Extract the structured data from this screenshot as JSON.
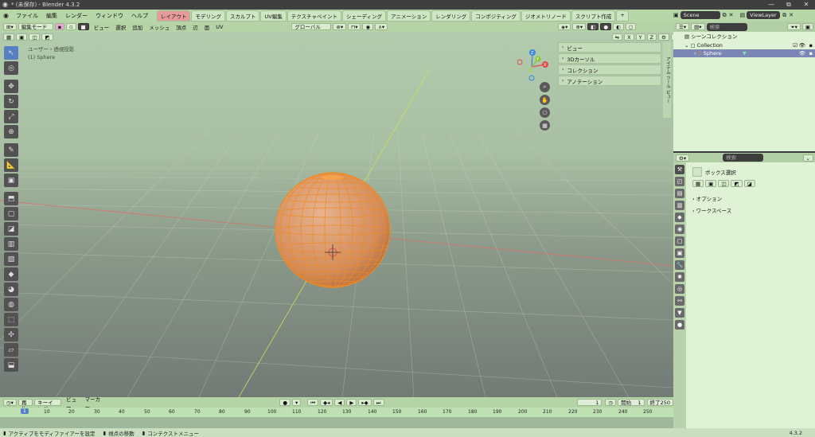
{
  "window": {
    "title": "* (未保存) - Blender 4.3.2",
    "controls": [
      "—",
      "⧉",
      "✕"
    ]
  },
  "menu": [
    "ファイル",
    "編集",
    "レンダー",
    "ウィンドウ",
    "ヘルプ"
  ],
  "workspaces": [
    {
      "label": "レイアウト",
      "active": true
    },
    {
      "label": "モデリング"
    },
    {
      "label": "スカルプト"
    },
    {
      "label": "UV編集"
    },
    {
      "label": "テクスチャペイント"
    },
    {
      "label": "シェーディング"
    },
    {
      "label": "アニメーション"
    },
    {
      "label": "レンダリング"
    },
    {
      "label": "コンポジティング"
    },
    {
      "label": "ジオメトリノード"
    },
    {
      "label": "スクリプト作成"
    }
  ],
  "add_tab": "+",
  "scene": {
    "name": "Scene",
    "viewlayer": "ViewLayer"
  },
  "viewport": {
    "mode": "編集モード",
    "menus": [
      "ビュー",
      "選択",
      "追加",
      "メッシュ",
      "頂点",
      "辺",
      "面",
      "UV"
    ],
    "orientation": "グローバル",
    "options_label": "オプション",
    "axis_lock": [
      "X",
      "Y",
      "Z"
    ],
    "view_name": "ユーザー・透視投影",
    "object_name": "(1) Sphere",
    "npanel": [
      "ビュー",
      "3Dカーソル",
      "コレクション",
      "アノテーション"
    ],
    "npanel_tabs": [
      "アイテム",
      "ツール",
      "ビュー"
    ],
    "gizmo_axes": [
      "X",
      "Y",
      "Z"
    ]
  },
  "timeline": {
    "playback": "再生",
    "keying": "キーイング",
    "view": "ビュー",
    "marker": "マーカー",
    "current_frame": "1",
    "start_label": "開始",
    "start": "1",
    "end_label": "終了",
    "end": "250",
    "ticks": [
      "10",
      "20",
      "30",
      "40",
      "50",
      "60",
      "70",
      "80",
      "90",
      "100",
      "110",
      "120",
      "130",
      "140",
      "150",
      "160",
      "170",
      "180",
      "190",
      "200",
      "210",
      "220",
      "230",
      "240",
      "250"
    ]
  },
  "statusbar": {
    "items": [
      "アクティブをモディファイアーを設定",
      "視点の移動",
      "コンテクストメニュー"
    ],
    "version": "4.3.2"
  },
  "outliner": {
    "search_placeholder": "検索",
    "scene_collection": "シーンコレクション",
    "collection": "Collection",
    "object": "Sphere"
  },
  "properties": {
    "search_placeholder": "検索",
    "tool_name": "ボックス選択",
    "sections": [
      "オプション",
      "ワークスペース"
    ]
  },
  "colors": {
    "accent": "#5680c2",
    "active_tab": "#e89b9b",
    "selection": "#f08a24",
    "axis_x": "#e04a4a",
    "axis_y": "#8fc33a",
    "axis_z": "#3a86e0"
  }
}
